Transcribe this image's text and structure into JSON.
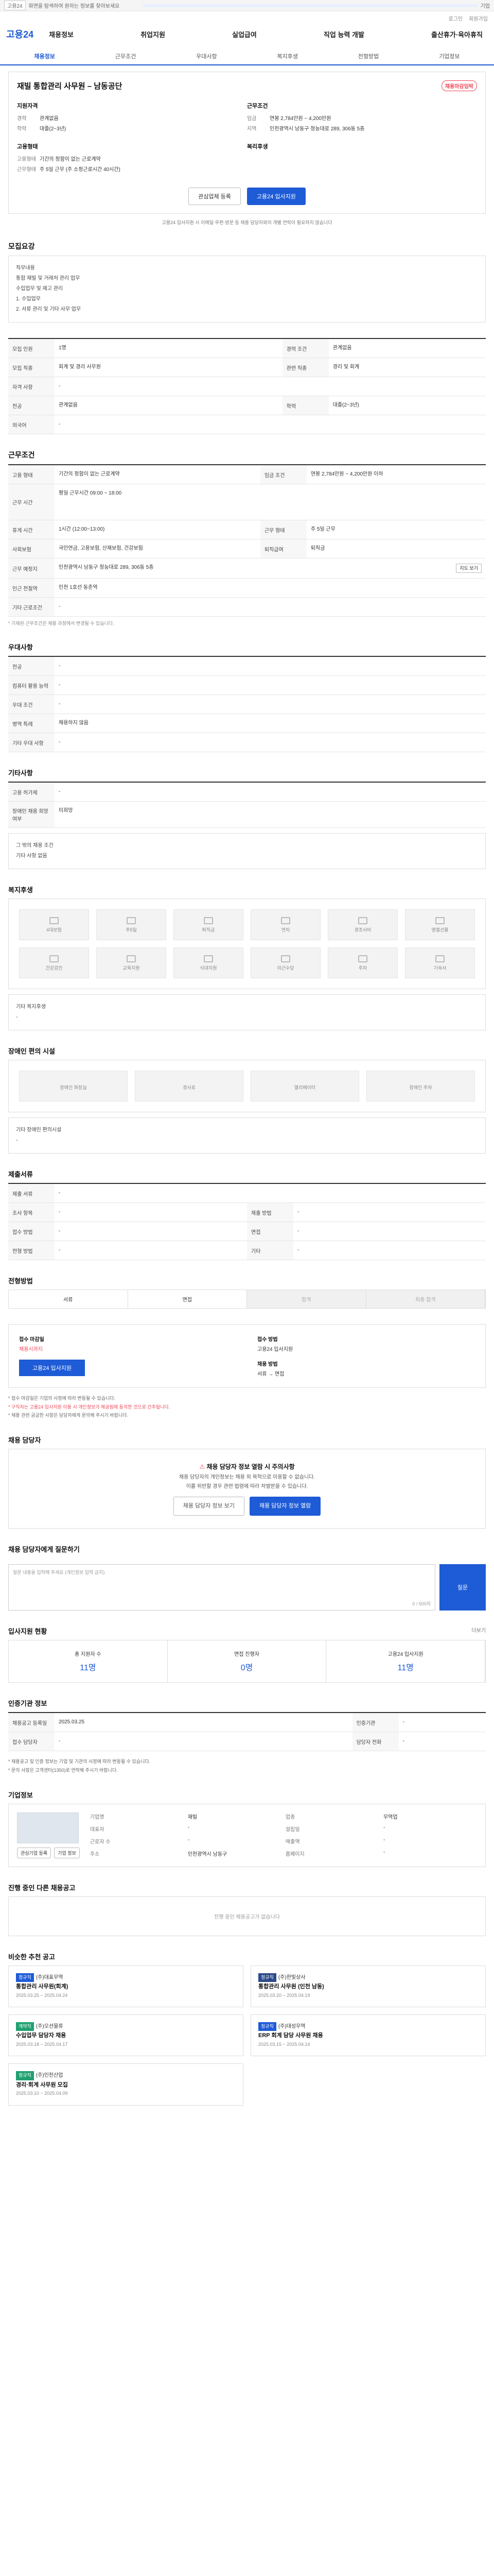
{
  "topbar": {
    "tag": "고용24",
    "notice": "화면을 탐색하여 원하는 정보를 찾아보세요",
    "label": "기업"
  },
  "toplinks": [
    "로그인",
    "회원가입"
  ],
  "brand": "고용24",
  "gnb": [
    "채용정보",
    "취업지원",
    "실업급여",
    "직업 능력 개발",
    "출산휴가·육아휴직"
  ],
  "tabs": [
    "채용정보",
    "근무조건",
    "우대사항",
    "복지후생",
    "전형방법",
    "기업정보"
  ],
  "job": {
    "title": "재빌 통합관리 사무원 – 남동공단",
    "badge": "채용마감임박",
    "left_title": "지원자격",
    "left": [
      [
        "경력",
        "관계없음"
      ],
      [
        "학력",
        "대졸(2~3년)"
      ]
    ],
    "right_title": "근무조건",
    "right": [
      [
        "임금",
        "연봉 2,784만원 ~ 4,200만원"
      ],
      [
        "지역",
        "인천광역시 남동구 청능대로 289, 306동 5층"
      ]
    ],
    "hire_title": "고용형태",
    "hire": [
      [
        "고용형태",
        "기간의 정함이 없는 근로계약"
      ],
      [
        "근무형태",
        "주 5일 근무 (주 소정근로시간 40시간)"
      ]
    ],
    "welfare_title": "복리후생",
    "btn_interest": "관심업체 등록",
    "btn_apply": "고용24 입사지원",
    "apply_note": "고용24 입사지원 시 이메일·우편·방문 등 채용 담당자와의 개별 연락이 필요하지 않습니다"
  },
  "summary": {
    "heading": "모집요강",
    "lines": [
      "직무내용",
      "통합 재빌 및 거래처 관리 업무",
      "수입업무 및 재고 관리",
      "1. 수입업무",
      "2. 서류 관리 및 기타 사무 업무"
    ]
  },
  "detail_rows": [
    [
      "모집 인원",
      "1명",
      "경력 조건",
      "관계없음"
    ],
    [
      "모집 직종",
      "회계 및 경리 사무원",
      "관련 직종",
      "경리 및 회계"
    ],
    [
      "자격 사항",
      "-",
      "",
      ""
    ],
    [
      "전공",
      "관계없음",
      "학력",
      "대졸(2~3년)"
    ],
    [
      "외국어",
      "-",
      "",
      ""
    ]
  ],
  "work": {
    "heading": "근무조건",
    "rows": [
      [
        "고용 형태",
        "기간의 정함이 없는 근로계약",
        "임금 조건",
        "연봉 2,784만원 ~ 4,200만원 이하"
      ],
      [
        "근무 시간",
        "평일 근무시간 09:00 ~ 18:00",
        "",
        ""
      ],
      [
        "휴게 시간",
        "1시간 (12:00~13:00)",
        "근무 형태",
        "주 5일 근무"
      ],
      [
        "사회보험",
        "국민연금, 고용보험, 산재보험, 건강보험",
        "퇴직급여",
        "퇴직금"
      ],
      [
        "근무 예정지",
        "인천광역시 남동구 청능대로 289, 306동 5층",
        "",
        ""
      ],
      [
        "인근 전철역",
        "인천 1호선 동춘역",
        "",
        ""
      ],
      [
        "기타 근로조건",
        "-",
        "",
        ""
      ]
    ],
    "map_btn": "지도 보기",
    "note": "* 기재된 근무조건은 채용 과정에서 변경될 수 있습니다."
  },
  "prefer": {
    "heading": "우대사항",
    "rows": [
      [
        "전공",
        "-"
      ],
      [
        "컴퓨터 활용 능력",
        "-"
      ],
      [
        "우대 조건",
        "-"
      ],
      [
        "병역 특례",
        "채용하지 않음"
      ],
      [
        "기타 우대 사항",
        "-"
      ]
    ]
  },
  "others": {
    "heading": "기타사항",
    "rows": [
      [
        "고용 허가제",
        "-"
      ],
      [
        "장애인 채용 희망 여부",
        "미희망"
      ]
    ],
    "extra": "그 밖의 채용 조건",
    "extra2": "기타 사항 없음"
  },
  "welfare": {
    "heading": "복지후생",
    "items": [
      "4대보험",
      "주5일",
      "퇴직금",
      "연차",
      "경조사비",
      "명절선물",
      "건강검진",
      "교육지원",
      "식대지원",
      "야근수당",
      "주차",
      "기숙사"
    ],
    "extra_label": "기타 복지후생",
    "extra": "-"
  },
  "disability": {
    "heading": "장애인 편의 시설",
    "items": [
      "장애인 화장실",
      "경사로",
      "엘리베이터",
      "장애인 주차"
    ],
    "extra_label": "기타 장애인 편의시설",
    "extra": "-"
  },
  "documents": {
    "heading": "제출서류",
    "rows": [
      [
        "제출 서류",
        "-",
        "",
        ""
      ],
      [
        "조사 항목",
        "-",
        "제출 방법",
        "-"
      ],
      [
        "접수 방법",
        "-",
        "면접",
        "-"
      ],
      [
        "전형 방법",
        "-",
        "기타",
        "-"
      ]
    ]
  },
  "process": {
    "heading": "전형방법",
    "steps": [
      "서류",
      "면접",
      "합격",
      "최종 합격"
    ]
  },
  "apply": {
    "deadline_label": "접수 마감일",
    "deadline": "채용시까지",
    "method_label": "접수 방법",
    "method": "고용24 입사지원",
    "contact_label": "채용 방법",
    "contact": "서류 → 면접",
    "btn": "고용24 입사지원",
    "notes": [
      "* 접수 마감일은 기업의 사정에 따라 변동될 수 있습니다.",
      "* 구직자는 고용24 입사지원 이용 시 개인정보가 제공됨에 동의한 것으로 간주됩니다.",
      "* 채용 관련 궁금한 사항은 담당자에게 문의해 주시기 바랍니다."
    ]
  },
  "warning": {
    "heading": "채용 담당자",
    "title_pre": "채용 담당자 정보 열람 시 주의사항",
    "lines": [
      "채용 담당자의 개인정보는 채용 외 목적으로 이용할 수 없습니다.",
      "이를 위반할 경우 관련 법령에 따라 처벌받을 수 있습니다."
    ],
    "btn1": "채용 담당자 정보 보기",
    "btn2": "채용 담당자 정보 열람"
  },
  "ask": {
    "heading": "채용 담당자에게 질문하기",
    "placeholder": "질문 내용을 입력해 주세요 (개인정보 입력 금지)",
    "count": "0 / 500자",
    "btn": "질문"
  },
  "stats": {
    "heading": "입사지원 현황",
    "link": "더보기",
    "items": [
      [
        "총 지원자 수",
        "11명"
      ],
      [
        "면접 진행자",
        "0명"
      ],
      [
        "고용24 입사지원",
        "11명"
      ]
    ]
  },
  "history": {
    "heading": "인증기관 정보",
    "rows": [
      [
        "채용공고 등록일",
        "2025.03.25",
        "인증기관",
        "-"
      ],
      [
        "접수 담당자",
        "-",
        "담당자 전화",
        "-"
      ]
    ],
    "notes": [
      "* 채용공고 및 인증 정보는 기업 및 기관의 사정에 따라 변동될 수 있습니다.",
      "* 문의 사항은 고객센터(1350)로 연락해 주시기 바랍니다."
    ]
  },
  "company": {
    "heading": "기업정보",
    "fields": [
      [
        "기업명",
        "재빌"
      ],
      [
        "업종",
        "무역업"
      ],
      [
        "대표자",
        "-"
      ],
      [
        "설립일",
        "-"
      ],
      [
        "근로자 수",
        "-"
      ],
      [
        "매출액",
        "-"
      ],
      [
        "주소",
        "인천광역시 남동구"
      ],
      [
        "홈페이지",
        "-"
      ]
    ],
    "btn1": "관심기업 등록",
    "btn2": "기업 정보"
  },
  "other_jobs": {
    "heading": "진행 중인 다른 채용공고",
    "empty": "진행 중인 채용공고가 없습니다"
  },
  "related": {
    "heading": "비슷한 추천 공고",
    "cards": [
      {
        "tag": "정규직",
        "color": "blue",
        "company": "(주)대표무역",
        "title": "통합관리 사무원(회계)",
        "date": "2025.03.25 ~ 2025.04.24"
      },
      {
        "tag": "정규직",
        "color": "navy",
        "company": "(주)한빛상사",
        "title": "통합관리 사무원 (인천 남동)",
        "date": "2025.03.20 ~ 2025.04.19"
      },
      {
        "tag": "계약직",
        "color": "green",
        "company": "(주)오션물류",
        "title": "수입업무 담당자 채용",
        "date": "2025.03.18 ~ 2025.04.17"
      },
      {
        "tag": "정규직",
        "color": "blue",
        "company": "(주)대성무역",
        "title": "ERP 회계 담당 사무원 채용",
        "date": "2025.03.15 ~ 2025.04.14"
      },
      {
        "tag": "정규직",
        "color": "green",
        "company": "(주)인천산업",
        "title": "경리·회계 사무원 모집",
        "date": "2025.03.10 ~ 2025.04.09"
      }
    ]
  }
}
